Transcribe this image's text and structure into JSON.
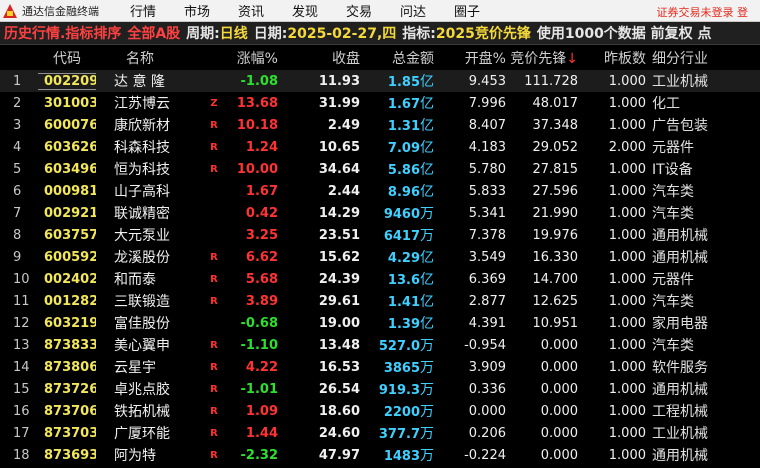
{
  "app": {
    "title": "通达信金融终端",
    "menu": [
      "行情",
      "市场",
      "资讯",
      "发现",
      "交易",
      "问达",
      "圈子"
    ],
    "warning": "证券交易未登录 登"
  },
  "infobar": {
    "title": "历史行情.指标排序",
    "scope": "全部A股",
    "period_label": "周期:",
    "period": "日线",
    "date_label": "日期:",
    "date": "2025-02-27,四",
    "indicator_label": "指标:",
    "indicator": "2025竞价先锋",
    "note": "使用1000个数据 前复权 点"
  },
  "columns": {
    "code": "代码",
    "name": "名称",
    "chg": "涨幅%",
    "price": "收盘",
    "amount": "总金额",
    "open": "开盘%",
    "bid": "竞价先锋",
    "bid_arrow": "↓",
    "board": "昨板数",
    "industry": "细分行业"
  },
  "rows": [
    {
      "idx": "1",
      "code": "002209",
      "name": "达 意 隆",
      "flag": "",
      "chg": "-1.08",
      "dir": "down",
      "price": "11.93",
      "amt": "1.85",
      "unit": "亿",
      "open": "9.453",
      "bid": "111.728",
      "board": "1.000",
      "ind": "工业机械"
    },
    {
      "idx": "2",
      "code": "301003",
      "name": "江苏博云",
      "flag": "Z",
      "chg": "13.68",
      "dir": "up",
      "price": "31.99",
      "amt": "1.67",
      "unit": "亿",
      "open": "7.996",
      "bid": "48.017",
      "board": "1.000",
      "ind": "化工"
    },
    {
      "idx": "3",
      "code": "600076",
      "name": "康欣新材",
      "flag": "R",
      "chg": "10.18",
      "dir": "up",
      "price": "2.49",
      "amt": "1.31",
      "unit": "亿",
      "open": "8.407",
      "bid": "37.348",
      "board": "1.000",
      "ind": "广告包装"
    },
    {
      "idx": "4",
      "code": "603626",
      "name": "科森科技",
      "flag": "R",
      "chg": "1.24",
      "dir": "up",
      "price": "10.65",
      "amt": "7.09",
      "unit": "亿",
      "open": "4.183",
      "bid": "29.052",
      "board": "2.000",
      "ind": "元器件"
    },
    {
      "idx": "5",
      "code": "603496",
      "name": "恒为科技",
      "flag": "R",
      "chg": "10.00",
      "dir": "up",
      "price": "34.64",
      "amt": "5.86",
      "unit": "亿",
      "open": "5.780",
      "bid": "27.815",
      "board": "1.000",
      "ind": "IT设备"
    },
    {
      "idx": "6",
      "code": "000981",
      "name": "山子高科",
      "flag": "",
      "chg": "1.67",
      "dir": "up",
      "price": "2.44",
      "amt": "8.96",
      "unit": "亿",
      "open": "5.833",
      "bid": "27.596",
      "board": "1.000",
      "ind": "汽车类"
    },
    {
      "idx": "7",
      "code": "002921",
      "name": "联诚精密",
      "flag": "",
      "chg": "0.42",
      "dir": "up",
      "price": "14.29",
      "amt": "9460",
      "unit": "万",
      "open": "5.341",
      "bid": "21.990",
      "board": "1.000",
      "ind": "汽车类"
    },
    {
      "idx": "8",
      "code": "603757",
      "name": "大元泵业",
      "flag": "",
      "chg": "3.25",
      "dir": "up",
      "price": "23.51",
      "amt": "6417",
      "unit": "万",
      "open": "7.378",
      "bid": "19.976",
      "board": "1.000",
      "ind": "通用机械"
    },
    {
      "idx": "9",
      "code": "600592",
      "name": "龙溪股份",
      "flag": "R",
      "chg": "6.62",
      "dir": "up",
      "price": "15.62",
      "amt": "4.29",
      "unit": "亿",
      "open": "3.549",
      "bid": "16.330",
      "board": "1.000",
      "ind": "通用机械"
    },
    {
      "idx": "10",
      "code": "002402",
      "name": "和而泰",
      "flag": "R",
      "chg": "5.68",
      "dir": "up",
      "price": "24.39",
      "amt": "13.6",
      "unit": "亿",
      "open": "6.369",
      "bid": "14.700",
      "board": "1.000",
      "ind": "元器件"
    },
    {
      "idx": "11",
      "code": "001282",
      "name": "三联锻造",
      "flag": "R",
      "chg": "3.89",
      "dir": "up",
      "price": "29.61",
      "amt": "1.41",
      "unit": "亿",
      "open": "2.877",
      "bid": "12.625",
      "board": "1.000",
      "ind": "汽车类"
    },
    {
      "idx": "12",
      "code": "603219",
      "name": "富佳股份",
      "flag": "",
      "chg": "-0.68",
      "dir": "down",
      "price": "19.00",
      "amt": "1.39",
      "unit": "亿",
      "open": "4.391",
      "bid": "10.951",
      "board": "1.000",
      "ind": "家用电器"
    },
    {
      "idx": "13",
      "code": "873833",
      "name": "美心翼申",
      "flag": "R",
      "chg": "-1.10",
      "dir": "down",
      "price": "13.48",
      "amt": "527.0",
      "unit": "万",
      "open": "-0.954",
      "bid": "0.000",
      "board": "1.000",
      "ind": "汽车类"
    },
    {
      "idx": "14",
      "code": "873806",
      "name": "云星宇",
      "flag": "R",
      "chg": "4.22",
      "dir": "up",
      "price": "16.53",
      "amt": "3865",
      "unit": "万",
      "open": "3.909",
      "bid": "0.000",
      "board": "1.000",
      "ind": "软件服务"
    },
    {
      "idx": "15",
      "code": "873726",
      "name": "卓兆点胶",
      "flag": "R",
      "chg": "-1.01",
      "dir": "down",
      "price": "26.54",
      "amt": "919.3",
      "unit": "万",
      "open": "0.336",
      "bid": "0.000",
      "board": "1.000",
      "ind": "通用机械"
    },
    {
      "idx": "16",
      "code": "873706",
      "name": "铁拓机械",
      "flag": "R",
      "chg": "1.09",
      "dir": "up",
      "price": "18.60",
      "amt": "2200",
      "unit": "万",
      "open": "0.000",
      "bid": "0.000",
      "board": "1.000",
      "ind": "工程机械"
    },
    {
      "idx": "17",
      "code": "873703",
      "name": "广厦环能",
      "flag": "R",
      "chg": "1.44",
      "dir": "up",
      "price": "24.60",
      "amt": "377.7",
      "unit": "万",
      "open": "0.206",
      "bid": "0.000",
      "board": "1.000",
      "ind": "工业机械"
    },
    {
      "idx": "18",
      "code": "873693",
      "name": "阿为特",
      "flag": "R",
      "chg": "-2.32",
      "dir": "down",
      "price": "47.97",
      "amt": "1483",
      "unit": "万",
      "open": "-0.224",
      "bid": "0.000",
      "board": "1.000",
      "ind": "通用机械"
    }
  ]
}
